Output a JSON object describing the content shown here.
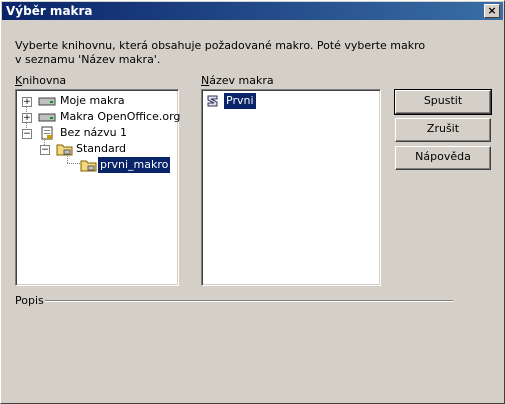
{
  "window": {
    "title": "Výběr makra",
    "close_label": "×"
  },
  "description_line1": "Vyberte knihovnu, která obsahuje požadované makro. Poté vyberte makro",
  "description_line2": "v seznamu 'Název makra'.",
  "library": {
    "label_first": "K",
    "label_rest": "nihovna",
    "items": [
      {
        "label": "Moje makra",
        "icon": "drive-icon"
      },
      {
        "label": "Makra OpenOffice.org",
        "icon": "drive-icon"
      },
      {
        "label": "Bez názvu 1",
        "icon": "document-icon"
      },
      {
        "label": "Standard",
        "icon": "folder-icon"
      },
      {
        "label": "prvni_makro",
        "icon": "module-icon"
      }
    ]
  },
  "macro_name": {
    "label_first": "N",
    "label_rest": "ázev makra",
    "items": [
      {
        "label": "Prvni",
        "icon": "macro-icon"
      }
    ]
  },
  "buttons": {
    "run": "Spustit",
    "cancel": "Zrušit",
    "help": "Nápověda"
  },
  "description_section": {
    "label": "Popis"
  }
}
